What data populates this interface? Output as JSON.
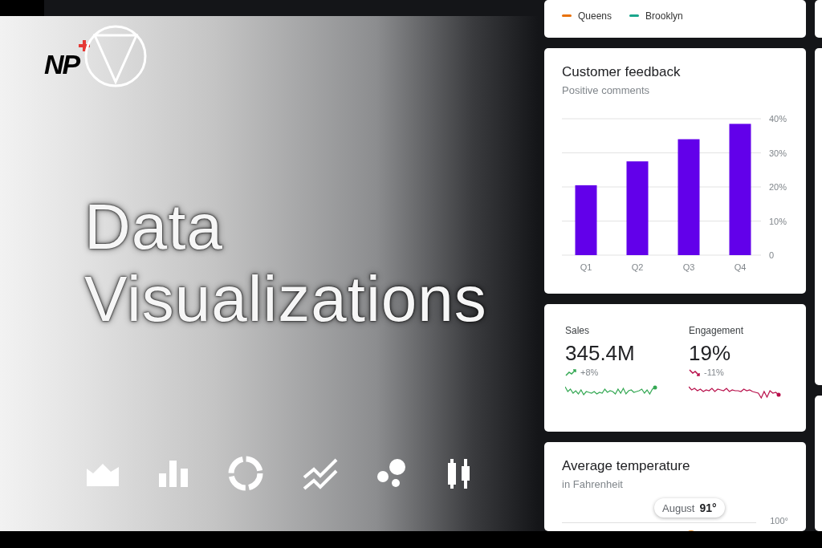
{
  "hero": {
    "logo_text": "NP",
    "title": "Data Visualizations",
    "chart_types": [
      {
        "kind": "area"
      },
      {
        "kind": "bar"
      },
      {
        "kind": "donut"
      },
      {
        "kind": "line"
      },
      {
        "kind": "bubble"
      },
      {
        "kind": "candlestick"
      }
    ]
  },
  "legend_card": {
    "items": [
      {
        "label": "Queens",
        "color": "#e8710a"
      },
      {
        "label": "Brooklyn",
        "color": "#1aa68c"
      }
    ]
  },
  "feedback_card": {
    "title": "Customer feedback",
    "subtitle": "Positive comments",
    "chart_data": {
      "type": "bar",
      "categories": [
        "Q1",
        "Q2",
        "Q3",
        "Q4"
      ],
      "values": [
        20.5,
        27.5,
        34,
        38.5
      ],
      "ylim": [
        0,
        40
      ],
      "grid": true,
      "yticks": [
        {
          "value": 0,
          "label": "0"
        },
        {
          "value": 10,
          "label": "10%"
        },
        {
          "value": 20,
          "label": "20%"
        },
        {
          "value": 30,
          "label": "30%"
        },
        {
          "value": 40,
          "label": "40%"
        }
      ]
    }
  },
  "metrics": [
    {
      "label": "Sales",
      "value": "345.4M",
      "kind": "up",
      "change": "+8%"
    },
    {
      "label": "Engagement",
      "value": "19%",
      "kind": "down",
      "change": "-11%"
    }
  ],
  "temperature_card": {
    "title": "Average temperature",
    "subtitle": "in Fahrenheit",
    "tooltip_label": "August",
    "tooltip_value": "91°",
    "axis_label": "100°"
  }
}
